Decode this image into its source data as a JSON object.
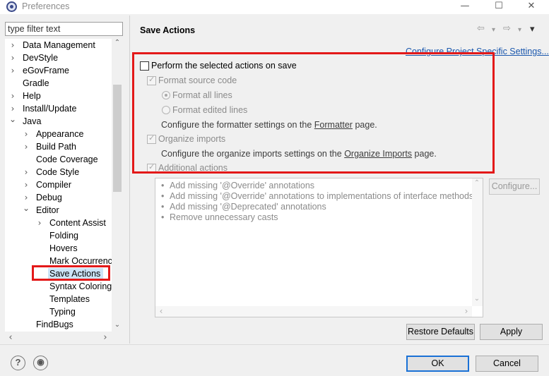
{
  "window": {
    "title": "Preferences",
    "minimize": "—",
    "maximize": "☐",
    "close": "✕"
  },
  "filter": {
    "placeholder": "type filter text"
  },
  "tree": [
    {
      "label": "Data Management",
      "twisty": "›"
    },
    {
      "label": "DevStyle",
      "twisty": "›"
    },
    {
      "label": "eGovFrame",
      "twisty": "›"
    },
    {
      "label": "Gradle",
      "twisty": ""
    },
    {
      "label": "Help",
      "twisty": "›"
    },
    {
      "label": "Install/Update",
      "twisty": "›"
    },
    {
      "label": "Java",
      "twisty": "⌄"
    },
    {
      "label": "Appearance",
      "twisty": "›"
    },
    {
      "label": "Build Path",
      "twisty": "›"
    },
    {
      "label": "Code Coverage",
      "twisty": ""
    },
    {
      "label": "Code Style",
      "twisty": "›"
    },
    {
      "label": "Compiler",
      "twisty": "›"
    },
    {
      "label": "Debug",
      "twisty": "›"
    },
    {
      "label": "Editor",
      "twisty": "⌄"
    },
    {
      "label": "Content Assist",
      "twisty": "›"
    },
    {
      "label": "Folding",
      "twisty": ""
    },
    {
      "label": "Hovers",
      "twisty": ""
    },
    {
      "label": "Mark Occurrences",
      "twisty": ""
    },
    {
      "label": "Save Actions",
      "twisty": "",
      "selected": true
    },
    {
      "label": "Syntax Coloring",
      "twisty": ""
    },
    {
      "label": "Templates",
      "twisty": ""
    },
    {
      "label": "Typing",
      "twisty": ""
    },
    {
      "label": "FindBugs",
      "twisty": ""
    }
  ],
  "page": {
    "title": "Save Actions",
    "back_icon": "⇦",
    "forward_icon": "⇨",
    "dropdown_icon": "▾",
    "menu_icon": "▾",
    "configure_link": "Configure Project Specific Settings..."
  },
  "options": {
    "perform": "Perform the selected actions on save",
    "format_source": "Format source code",
    "format_all": "Format all lines",
    "format_edited": "Format edited lines",
    "formatter_prefix": "Configure the formatter settings on the ",
    "formatter_link": "Formatter",
    "formatter_suffix": " page.",
    "organize_imports": "Organize imports",
    "organize_prefix": "Configure the organize imports settings on the ",
    "organize_link": "Organize Imports",
    "organize_suffix": " page.",
    "additional_actions": "Additional actions"
  },
  "actions": [
    "Add missing '@Override' annotations",
    "Add missing '@Override' annotations to implementations of interface methods",
    "Add missing '@Deprecated' annotations",
    "Remove unnecessary casts"
  ],
  "buttons": {
    "configure": "Configure...",
    "restore_defaults": "Restore Defaults",
    "apply": "Apply",
    "ok": "OK",
    "cancel": "Cancel"
  },
  "footer": {
    "help_icon": "?",
    "import_icon": "◉"
  },
  "scroll": {
    "up": "⌃",
    "down": "⌄",
    "left": "‹",
    "right": "›"
  }
}
